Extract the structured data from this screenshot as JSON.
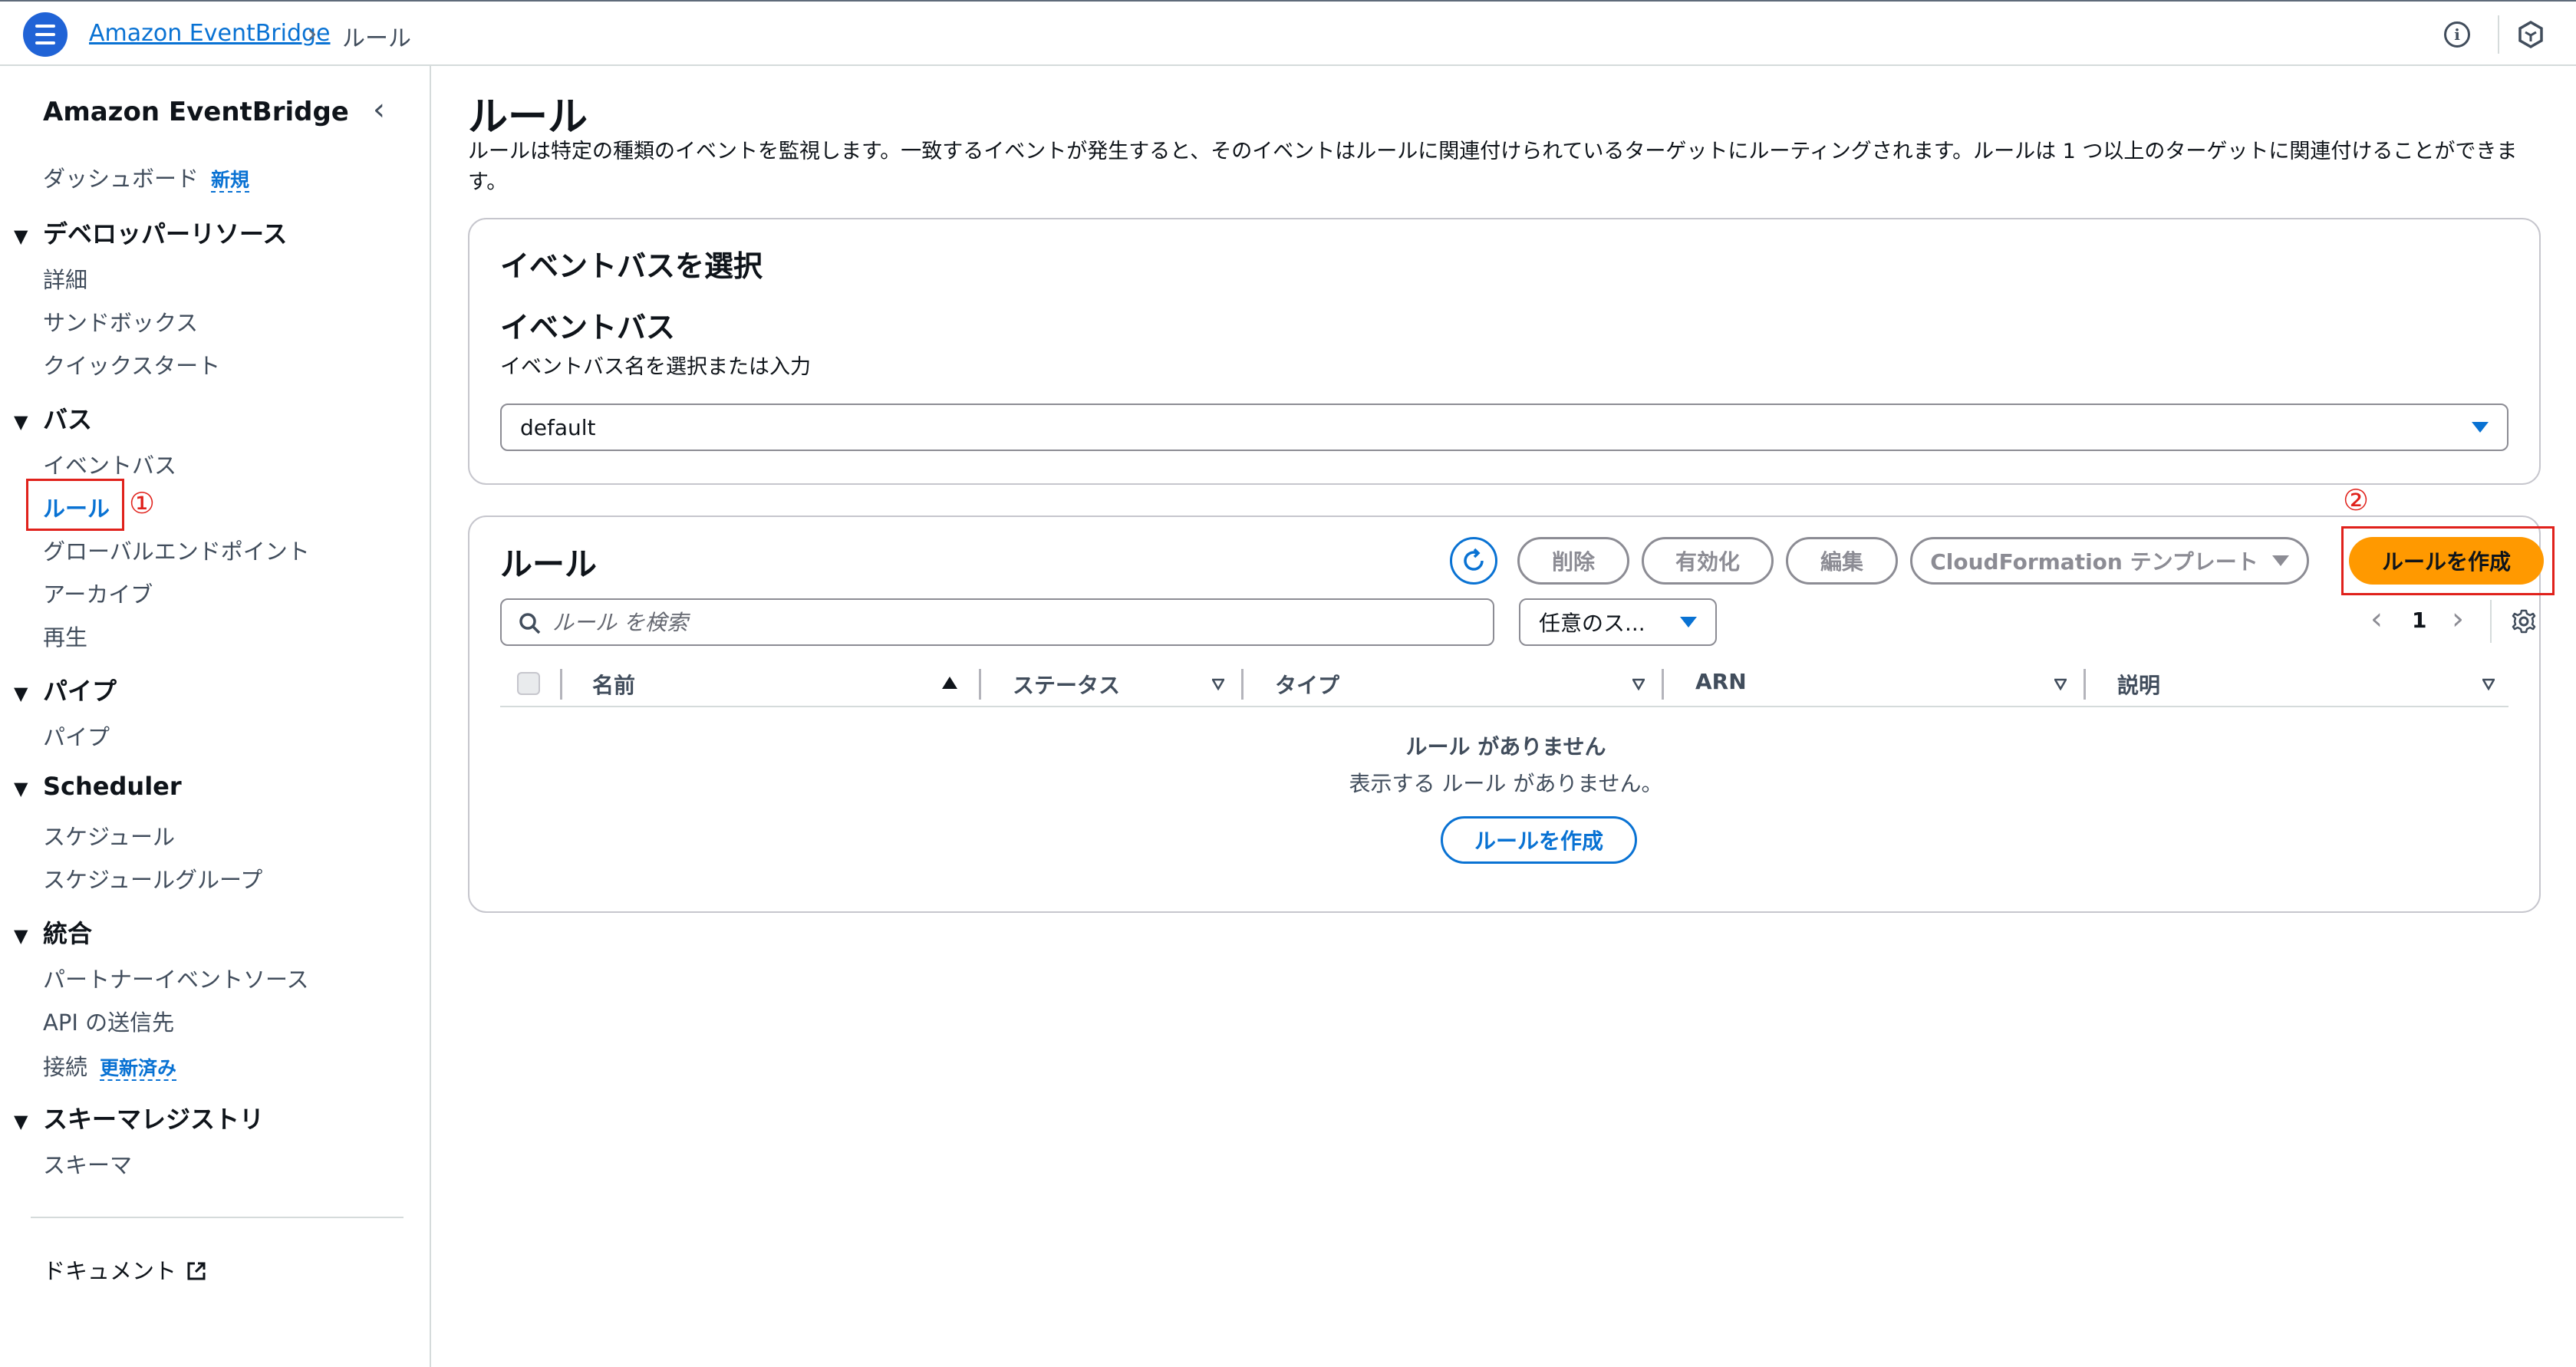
{
  "header": {
    "breadcrumb_service": "Amazon EventBridge",
    "breadcrumb_separator": "›",
    "breadcrumb_current": "ルール",
    "icons": [
      "menu-icon",
      "info-icon",
      "hexagon-icon"
    ]
  },
  "sidebar": {
    "title": "Amazon EventBridge",
    "collapse_glyph": "‹",
    "dashboard": {
      "label": "ダッシュボード",
      "badge": "新規"
    },
    "sections": [
      {
        "label": "デベロッパーリソース",
        "items": [
          "詳細",
          "サンドボックス",
          "クイックスタート"
        ]
      },
      {
        "label": "バス",
        "items": [
          "イベントバス",
          "ルール",
          "グローバルエンドポイント",
          "アーカイブ",
          "再生"
        ]
      },
      {
        "label": "パイプ",
        "items": [
          "パイプ"
        ]
      },
      {
        "label": "Scheduler",
        "items": [
          "スケジュール",
          "スケジュールグループ"
        ]
      },
      {
        "label": "統合",
        "items": [
          "パートナーイベントソース",
          "API の送信先",
          "接続"
        ]
      },
      {
        "label": "スキーマレジストリ",
        "items": [
          "スキーマ"
        ]
      }
    ],
    "connections_badge": "更新済み",
    "documentation": "ドキュメント",
    "active_item": "ルール",
    "annotation_1": "①"
  },
  "main": {
    "title": "ルール",
    "description": "ルールは特定の種類のイベントを監視します。一致するイベントが発生すると、そのイベントはルールに関連付けられているターゲットにルーティングされます。ルールは 1 つ以上のターゲットに関連付けることができます。",
    "event_bus_panel": {
      "heading": "イベントバスを選択",
      "field_label": "イベントバス",
      "field_hint": "イベントバス名を選択または入力",
      "selected_value": "default"
    },
    "rules_panel": {
      "heading": "ルール",
      "buttons": {
        "delete": "削除",
        "enable": "有効化",
        "edit": "編集",
        "cloudformation": "CloudFormation テンプレート",
        "create": "ルールを作成"
      },
      "annotation_2": "②",
      "search_placeholder": "ルール を検索",
      "filter_value": "任意のス...",
      "pagination": {
        "prev": "‹",
        "page": "1",
        "next": "›"
      },
      "columns": [
        "名前",
        "ステータス",
        "タイプ",
        "ARN",
        "説明"
      ],
      "empty_title": "ルール がありません",
      "empty_subtitle": "表示する ルール がありません。",
      "empty_create_button": "ルールを作成"
    }
  },
  "colors": {
    "link": "#0972d3",
    "primary_button": "#ff9900",
    "annotation": "#e0211b",
    "menu_button": "#2063d6"
  }
}
